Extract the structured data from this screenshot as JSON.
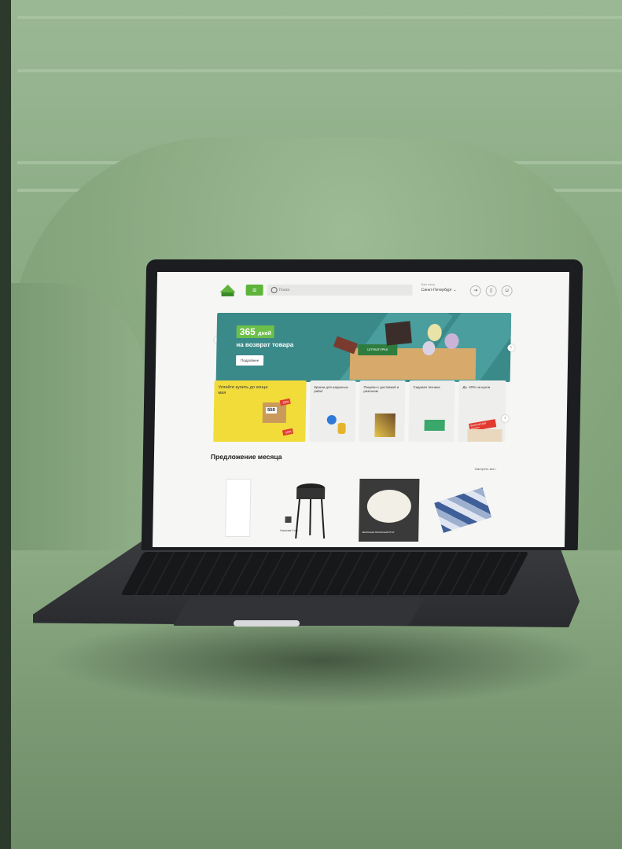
{
  "header": {
    "search_placeholder": "Поиск",
    "city_label": "Ваш город",
    "city": "Санкт-Петербург"
  },
  "banner": {
    "badge_number": "365",
    "badge_word": "дней",
    "subtitle": "на возврат товара",
    "button": "Подробнее",
    "box_label": "ШТУКАТУРКА"
  },
  "promo_tiles": [
    {
      "label": "Успейте купить до конца мая"
    },
    {
      "label": "Краски для наружных работ"
    },
    {
      "label": "Покупки с доставкой и разгоном"
    },
    {
      "label": "Садовая техника"
    },
    {
      "label": "До -20% на кухни"
    }
  ],
  "promo_tags": {
    "price": "550",
    "discount1": "-25%",
    "discount2": "-10%",
    "free_project": "Бесплатный проект"
  },
  "offers": {
    "title": "Предложение месяца",
    "see_all": "Смотреть все"
  },
  "products": [
    {
      "note": ""
    },
    {
      "note": "Наличие 2 шт."
    },
    {
      "note": "светильник потолочный 25 м²"
    },
    {
      "note": ""
    }
  ],
  "colors": {
    "accent_green": "#5fb33b",
    "banner_teal": "#3a8a8a",
    "promo_yellow": "#f1dc3a"
  }
}
